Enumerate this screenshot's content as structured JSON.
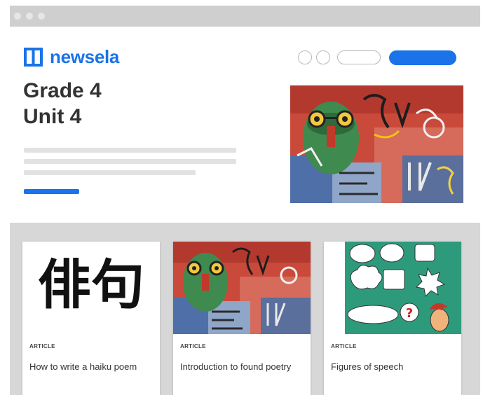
{
  "brand": {
    "name": "newsela",
    "logo_icon": "newsela-logo-icon",
    "color": "#1a73e8"
  },
  "hero": {
    "title_line1": "Grade 4",
    "title_line2": "Unit 4",
    "image": "graffiti-mural-image"
  },
  "header_controls": {
    "circle_buttons": 2,
    "cta_color": "#1a73e8"
  },
  "cards": [
    {
      "type": "ARTICLE",
      "title": "How to write a haiku poem",
      "image": "haiku-calligraphy-image",
      "calligraphy": "俳句"
    },
    {
      "type": "ARTICLE",
      "title": "Introduction to found poetry",
      "image": "graffiti-mural-image"
    },
    {
      "type": "ARTICLE",
      "title": "Figures of speech",
      "image": "speech-bubbles-image",
      "mark": "?"
    }
  ]
}
